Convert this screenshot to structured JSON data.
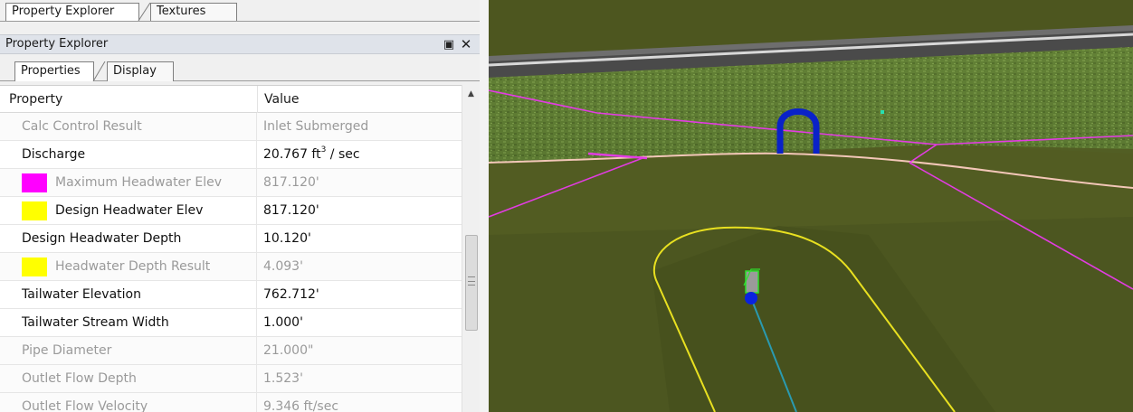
{
  "tabs": {
    "top": [
      {
        "label": "Property Explorer",
        "active": true
      },
      {
        "label": "Textures",
        "active": false
      }
    ],
    "sub": [
      {
        "label": "Properties",
        "active": true
      },
      {
        "label": "Display",
        "active": false
      }
    ]
  },
  "panel": {
    "title": "Property Explorer",
    "float_icon": "float-window-icon",
    "close_icon": "close-icon"
  },
  "grid": {
    "headers": {
      "property": "Property",
      "value": "Value"
    },
    "rows": [
      {
        "property": "Calc Control Result",
        "value": "Inlet Submerged",
        "readonly": true
      },
      {
        "property": "Discharge",
        "value": "20.767 ft",
        "value_sup": "3",
        "value_suffix": " / sec",
        "readonly": false
      },
      {
        "property": "Maximum Headwater Elev",
        "value": "817.120'",
        "readonly": true,
        "swatch": "#ff00ff"
      },
      {
        "property": "Design Headwater Elev",
        "value": "817.120'",
        "readonly": false,
        "swatch": "#ffff00"
      },
      {
        "property": "Design Headwater Depth",
        "value": "10.120'",
        "readonly": false
      },
      {
        "property": "Headwater Depth Result",
        "value": "4.093'",
        "readonly": true,
        "swatch": "#ffff00"
      },
      {
        "property": "Tailwater Elevation",
        "value": "762.712'",
        "readonly": false
      },
      {
        "property": "Tailwater Stream Width",
        "value": "1.000'",
        "readonly": false
      },
      {
        "property": "Pipe Diameter",
        "value": "21.000\"",
        "readonly": true
      },
      {
        "property": "Outlet Flow Depth",
        "value": "1.523'",
        "readonly": true
      },
      {
        "property": "Outlet Flow Velocity",
        "value": "9.346 ft/sec",
        "readonly": true
      }
    ]
  },
  "scrollbar": {
    "up_icon": "scroll-up-arrow-icon",
    "position_fraction": 0.46
  },
  "colors": {
    "magenta_swatch": "#ff00ff",
    "yellow_swatch": "#ffff00",
    "readonly_text": "#9a9a9a",
    "editable_text": "#111111"
  }
}
